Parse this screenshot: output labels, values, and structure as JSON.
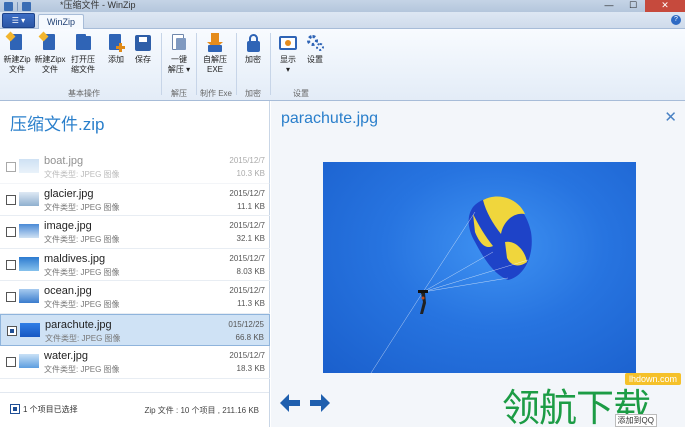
{
  "window": {
    "title": "*压缩文件 - WinZip",
    "close_glyph": "✕",
    "minimize_glyph": "—",
    "maximize_glyph": "☐"
  },
  "tabs": {
    "file_menu": "☰ ▾",
    "active_tab": "WinZip",
    "help_glyph": "?"
  },
  "ribbon": {
    "buttons": [
      {
        "label": "新建Zip\n文件",
        "icon": "new-zip-icon"
      },
      {
        "label": "新建Zipx\n文件",
        "icon": "new-zipx-icon"
      },
      {
        "label": "打开压\n缩文件",
        "icon": "open-archive-icon"
      },
      {
        "label": "添加",
        "icon": "add-file-icon"
      },
      {
        "label": "保存",
        "icon": "save-icon"
      },
      {
        "label": "一键\n解压 ▾",
        "icon": "one-click-unzip-icon"
      },
      {
        "label": "自解压\nEXE",
        "icon": "self-extract-icon"
      },
      {
        "label": "加密",
        "icon": "lock-icon"
      },
      {
        "label": "显示\n▾",
        "icon": "view-icon"
      },
      {
        "label": "设置",
        "icon": "settings-icon"
      }
    ],
    "groups": [
      "基本操作",
      "解压",
      "制作 Exe",
      "加密",
      "设置"
    ]
  },
  "archive": {
    "title": "压缩文件.zip",
    "files": [
      {
        "name": "boat.jpg",
        "type": "文件类型: JPEG 图像",
        "date": "2015/12/7",
        "size": "10.3 KB",
        "checked": false
      },
      {
        "name": "glacier.jpg",
        "type": "文件类型: JPEG 图像",
        "date": "2015/12/7",
        "size": "11.1 KB",
        "checked": false
      },
      {
        "name": "image.jpg",
        "type": "文件类型: JPEG 图像",
        "date": "2015/12/7",
        "size": "32.1 KB",
        "checked": false
      },
      {
        "name": "maldives.jpg",
        "type": "文件类型: JPEG 图像",
        "date": "2015/12/7",
        "size": "8.03 KB",
        "checked": false
      },
      {
        "name": "ocean.jpg",
        "type": "文件类型: JPEG 图像",
        "date": "2015/12/7",
        "size": "11.3 KB",
        "checked": false
      },
      {
        "name": "parachute.jpg",
        "type": "文件类型: JPEG 图像",
        "date": "015/12/25",
        "size": "66.8 KB",
        "checked": true
      },
      {
        "name": "water.jpg",
        "type": "文件类型: JPEG 图像",
        "date": "2015/12/7",
        "size": "18.3 KB",
        "checked": false
      }
    ],
    "selection_status": "1 个项目已选择",
    "zip_info": "Zip 文件 : 10 个项目 , 211.16 KB"
  },
  "preview": {
    "title": "parachute.jpg",
    "close_glyph": "✕"
  },
  "watermark": {
    "url": "lhdown.com",
    "text": "领航下载",
    "qq": "添加到QQ"
  }
}
